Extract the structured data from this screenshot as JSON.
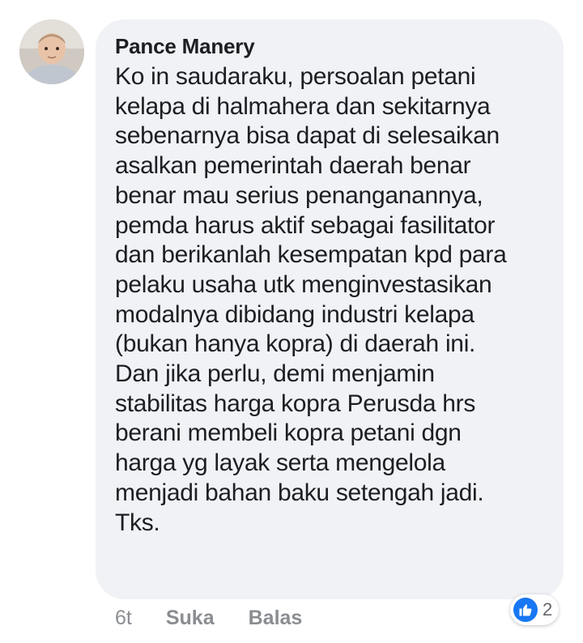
{
  "comment": {
    "author": "Pance Manery",
    "lines": [
      "Ko in saudaraku, persoalan petani",
      "kelapa di halmahera dan sekitarnya",
      "sebenarnya bisa dapat di selesaikan",
      "asalkan pemerintah daerah benar",
      "benar mau serius penanganannya,",
      "pemda harus aktif sebagai fasilitator",
      "dan berikanlah kesempatan kpd para",
      "pelaku usaha utk menginvestasikan",
      "modalnya dibidang industri kelapa",
      "(bukan hanya kopra) di daerah ini.",
      "Dan jika perlu, demi menjamin",
      "stabilitas harga kopra Perusda hrs",
      "berani membeli kopra petani dgn",
      "harga yg layak serta mengelola",
      "menjadi bahan baku setengah jadi.",
      "Tks."
    ]
  },
  "actions": {
    "time": "6t",
    "like_label": "Suka",
    "reply_label": "Balas"
  },
  "reactions": {
    "icon": "thumbs-up-icon",
    "count": "2",
    "color": "#1877f2"
  },
  "colors": {
    "bubble": "#f0f2f5",
    "text": "#1c1e21",
    "muted": "#8a8d91"
  }
}
